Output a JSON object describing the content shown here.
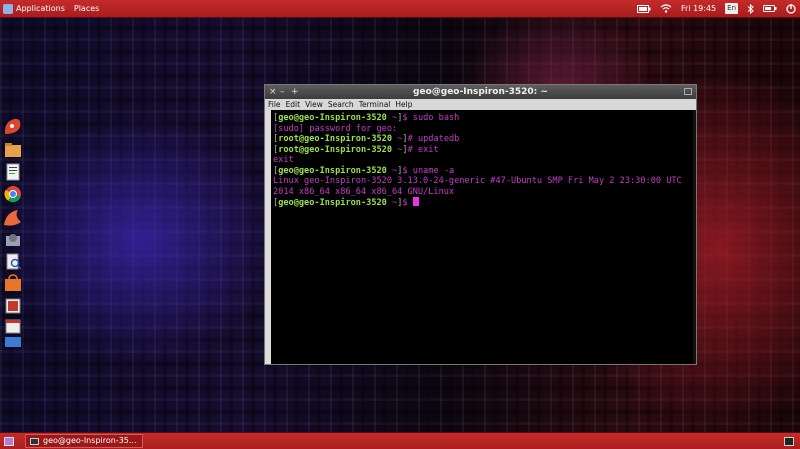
{
  "top_panel": {
    "menus": [
      "Applications",
      "Places"
    ],
    "clock": "Fri 19:45",
    "keyboard_layout": "En",
    "tray_icons": [
      "battery-icon",
      "wifi-icon",
      "bluetooth-icon",
      "volume-icon",
      "system-menu-icon"
    ]
  },
  "launcher": {
    "icons": [
      "paint-icon",
      "files-icon",
      "text-editor-icon",
      "chrome-icon",
      "ubuntu-tweak-icon",
      "settings-icon",
      "document-viewer-icon",
      "software-center-icon",
      "terminal-icon",
      "calendar-icon",
      "folder-icon"
    ]
  },
  "terminal": {
    "title": "geo@geo-Inspiron-3520: ~",
    "window_controls": [
      "×",
      "–",
      "+"
    ],
    "menu": [
      "File",
      "Edit",
      "View",
      "Search",
      "Terminal",
      "Help"
    ],
    "lines": [
      {
        "kind": "prompt",
        "user": "geo@geo-Inspiron-3520",
        "path": "~",
        "sym": "$",
        "cmd": "sudo bash"
      },
      {
        "kind": "output",
        "text": "[sudo] password for geo:"
      },
      {
        "kind": "prompt",
        "user": "root@geo-Inspiron-3520",
        "path": "~",
        "sym": "#",
        "cmd": "updatedb"
      },
      {
        "kind": "prompt",
        "user": "root@geo-Inspiron-3520",
        "path": "~",
        "sym": "#",
        "cmd": "exit"
      },
      {
        "kind": "output",
        "text": "exit"
      },
      {
        "kind": "prompt",
        "user": "geo@geo-Inspiron-3520",
        "path": "~",
        "sym": "$",
        "cmd": "uname -a"
      },
      {
        "kind": "output",
        "text": "Linux geo-Inspiron-3520 3.13.0-24-generic #47-Ubuntu SMP Fri May 2 23:30:00 UTC"
      },
      {
        "kind": "output",
        "text": "2014 x86_64 x86_64 x86_64 GNU/Linux"
      },
      {
        "kind": "prompt",
        "user": "geo@geo-Inspiron-3520",
        "path": "~",
        "sym": "$",
        "cmd": ""
      }
    ]
  },
  "bottom_panel": {
    "task_label": "geo@geo-Inspiron-35..."
  },
  "colors": {
    "panel_red": "#b52222",
    "prompt_green": "#9ae04f",
    "terminal_magenta": "#c13fc1"
  }
}
